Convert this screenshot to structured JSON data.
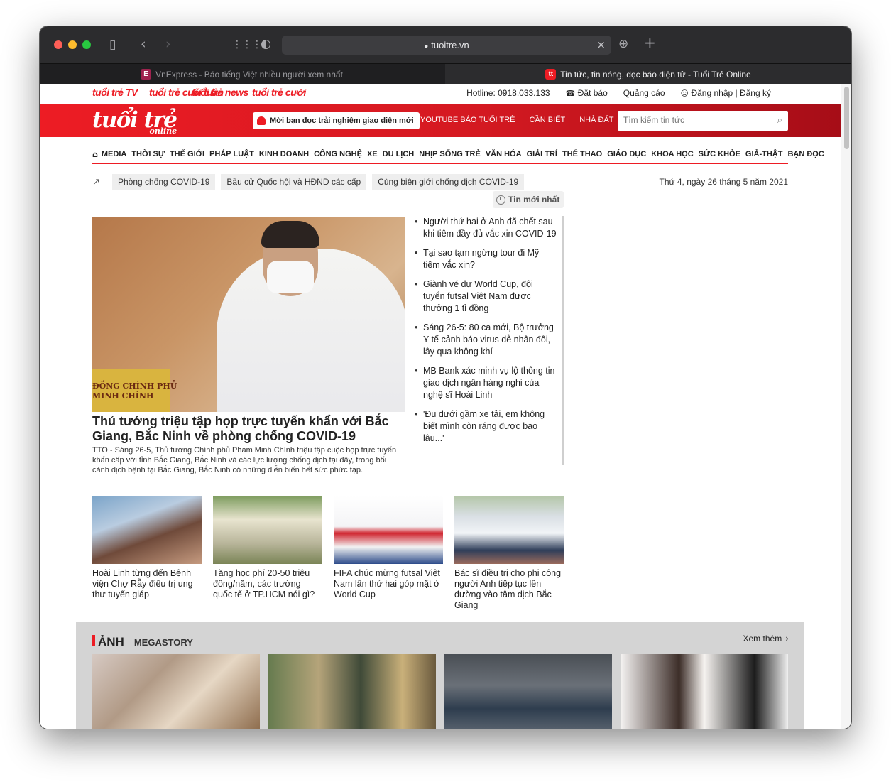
{
  "browser": {
    "url": "tuoitre.vn",
    "tabs": [
      {
        "title": "VnExpress - Báo tiếng Việt nhiều người xem nhất",
        "favicon": "E"
      },
      {
        "title": "Tin tức, tin nóng, đọc báo điện tử - Tuổi Trẻ Online",
        "favicon": "tt"
      }
    ],
    "icons": [
      "sidebar-icon",
      "back-icon",
      "forward-icon",
      "tab-overview-icon",
      "shield-icon",
      "lock-icon",
      "close-icon",
      "download-icon",
      "new-tab-icon"
    ]
  },
  "topbar": {
    "brands": [
      "tuổi trẻ TV",
      "tuổi trẻ cuối tuần",
      "tuổi trẻ news",
      "tuổi trẻ cười"
    ],
    "hotline": "Hotline: 0918.033.133",
    "subscribe": "Đặt báo",
    "ads": "Quảng cáo",
    "login": "Đăng nhập | Đăng ký"
  },
  "header": {
    "logo": "tuổi trẻ",
    "logo_sub": "online",
    "promo": "Mời bạn đọc trải nghiệm giao diện mới",
    "links": [
      "YOUTUBE BÁO TUỔI TRẺ",
      "CẦN BIẾT",
      "NHÀ ĐẤT"
    ],
    "search_placeholder": "Tìm kiếm tin tức",
    "colors": {
      "brand_red": "#ed1c24",
      "dark_red": "#a60d17"
    }
  },
  "nav": [
    "MEDIA",
    "THỜI SỰ",
    "THẾ GIỚI",
    "PHÁP LUẬT",
    "KINH DOANH",
    "CÔNG NGHỆ",
    "XE",
    "DU LỊCH",
    "NHỊP SỐNG TRẺ",
    "VĂN HÓA",
    "GIẢI TRÍ",
    "THỂ THAO",
    "GIÁO DỤC",
    "KHOA HỌC",
    "SỨC KHỎE",
    "GIẢ-THẬT",
    "BẠN ĐỌC"
  ],
  "hot_topics": [
    "Phòng chống COVID-19",
    "Bầu cử Quốc hội và HĐND các cấp",
    "Cùng biên giới chống dịch COVID-19"
  ],
  "date": "Thứ 4, ngày 26 tháng 5 năm 2021",
  "latest_label": "Tin mới nhất",
  "hero": {
    "title": "Thủ tướng triệu tập họp trực tuyến khẩn với Bắc Giang, Bắc Ninh về phòng chống COVID-19",
    "sapo": "TTO - Sáng 26-5, Thủ tướng Chính phủ Phạm Minh Chính triệu tập cuộc họp trực tuyến khẩn cấp với tỉnh Bắc Giang, Bắc Ninh và các lực lượng chống dịch tại đây, trong bối cảnh dịch bệnh tại Bắc Giang, Bắc Ninh có những diễn biến hết sức phức tạp.",
    "plate_text": "ĐỒNG CHÍNH PHỦ\nMINH CHÍNH"
  },
  "latest": [
    "Người thứ hai ở Anh đã chết sau khi tiêm đầy đủ vắc xin COVID-19",
    "Tại sao tạm ngừng tour đi Mỹ tiêm vắc xin?",
    "Giành vé dự World Cup, đội tuyển futsal Việt Nam được thưởng 1 tỉ đồng",
    "Sáng 26-5: 80 ca mới, Bộ trưởng Y tế cảnh báo virus dễ nhân đôi, lây qua không khí",
    "MB Bank xác minh vụ lộ thông tin giao dịch ngân hàng nghi của nghệ sĩ Hoài Linh",
    "'Đu dưới gầm xe tải, em không biết mình còn ráng được bao lâu...'"
  ],
  "cards": [
    {
      "title": "Hoài Linh từng đến Bệnh viện Chợ Rẫy điều trị ung thư tuyến giáp"
    },
    {
      "title": "Tăng học phí 20-50 triệu đồng/năm, các trường quốc tế ở TP.HCM nói gì?"
    },
    {
      "title": "FIFA chúc mừng futsal Việt Nam lần thứ hai góp mặt ở World Cup"
    },
    {
      "title": "Bác sĩ điều trị cho phi công người Anh tiếp tục lên đường vào tâm dịch Bắc Giang"
    }
  ],
  "photo_section": {
    "title": "ẢNH",
    "sub": "MEGASTORY",
    "more": "Xem thêm"
  }
}
